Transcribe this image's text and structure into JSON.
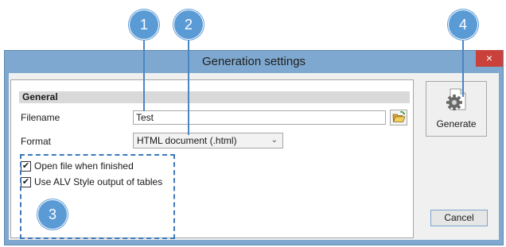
{
  "window": {
    "title": "Generation settings",
    "close_glyph": "×"
  },
  "general": {
    "section_title": "General",
    "filename_label": "Filename",
    "filename_value": "Test",
    "format_label": "Format",
    "format_selected": "HTML document (.html)",
    "options": [
      {
        "label": "Open file when finished",
        "checked": true
      },
      {
        "label": "Use ALV Style output of tables",
        "checked": true
      }
    ]
  },
  "actions": {
    "generate_label": "Generate",
    "cancel_label": "Cancel"
  },
  "callouts": [
    "1",
    "2",
    "3",
    "4"
  ],
  "icons": {
    "browse": "folder-open-icon",
    "generate": "document-gear-icon",
    "dropdown": "chevron-down-icon"
  },
  "colors": {
    "callout": "#5b9bd5",
    "dashed_box": "#3b78b8",
    "close_button": "#c9413a",
    "window_frame": "#7ea8cf"
  }
}
